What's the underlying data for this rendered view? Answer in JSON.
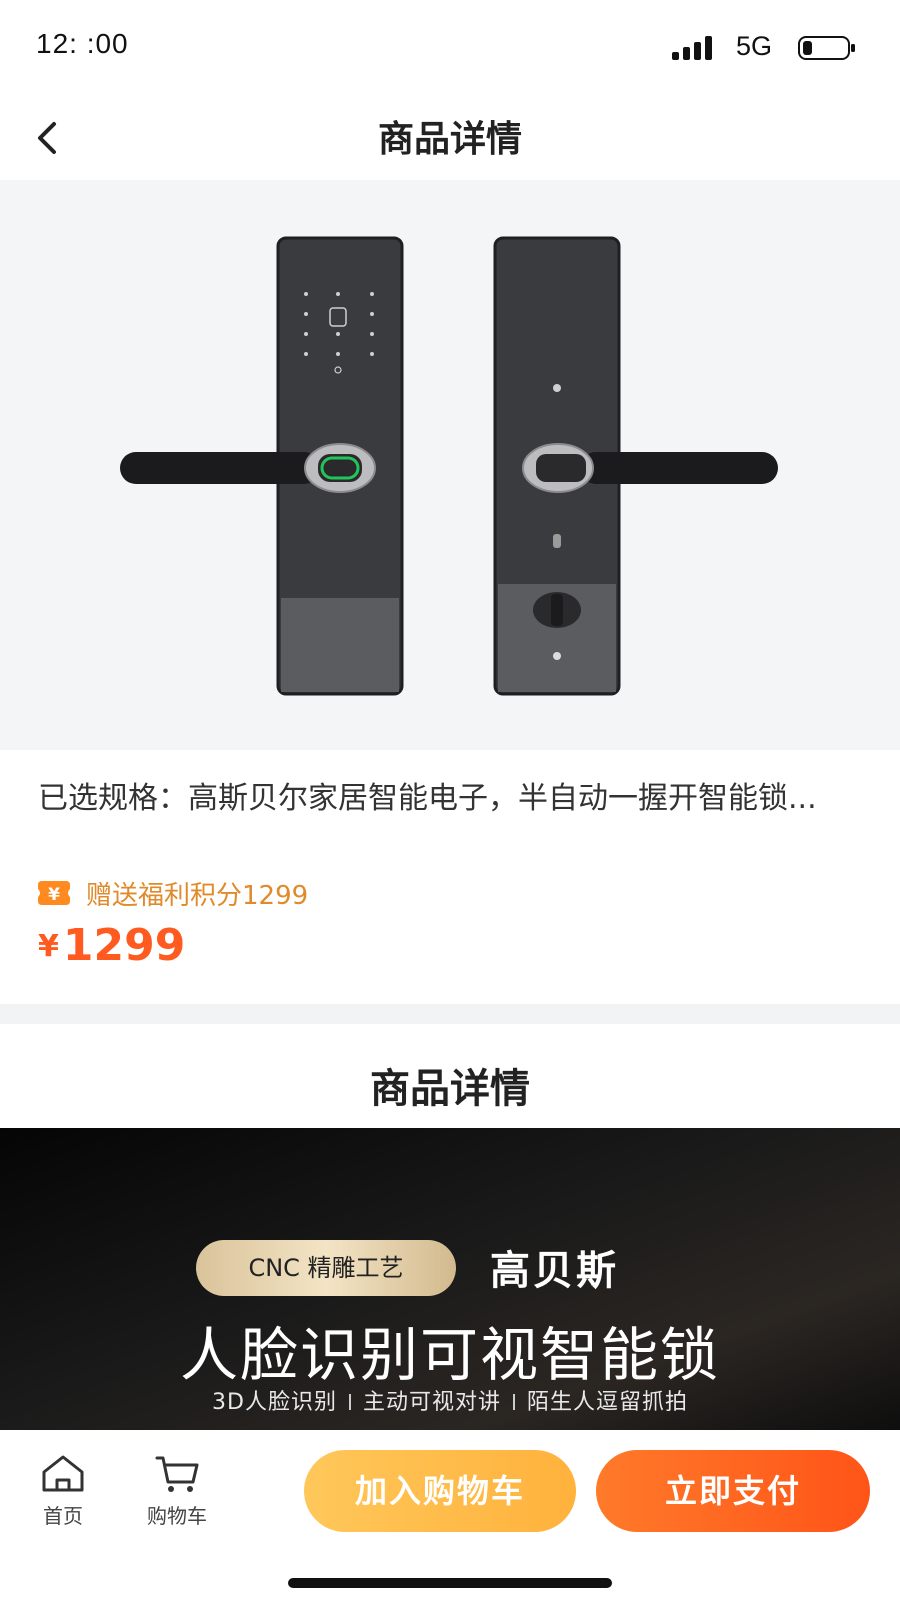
{
  "status_bar": {
    "time": "12:  :00",
    "network": "5G"
  },
  "nav": {
    "title": "商品详情"
  },
  "product": {
    "spec_text": "已选规格：高斯贝尔家居智能电子，半自动一握开智能锁...",
    "points_text": "赠送福利积分1299",
    "price_currency": "¥",
    "price_value": "1299"
  },
  "detail": {
    "title": "商品详情"
  },
  "banner": {
    "pill_text": "CNC 精雕工艺",
    "brand": "高贝斯",
    "headline": "人脸识别可视智能锁",
    "features": [
      "3D人脸识别",
      "主动可视对讲",
      "陌生人逗留抓拍"
    ]
  },
  "bottom_bar": {
    "home_label": "首页",
    "cart_label": "购物车",
    "add_to_cart": "加入购物车",
    "pay_now": "立即支付"
  },
  "colors": {
    "price": "#ff5a1f",
    "points": "#e08a2a",
    "add_cart_btn": "#ffb23c",
    "pay_btn": "#ff5418"
  },
  "icons": [
    "back-icon",
    "home-icon",
    "cart-icon",
    "points-badge-icon",
    "signal-icon",
    "battery-icon"
  ]
}
